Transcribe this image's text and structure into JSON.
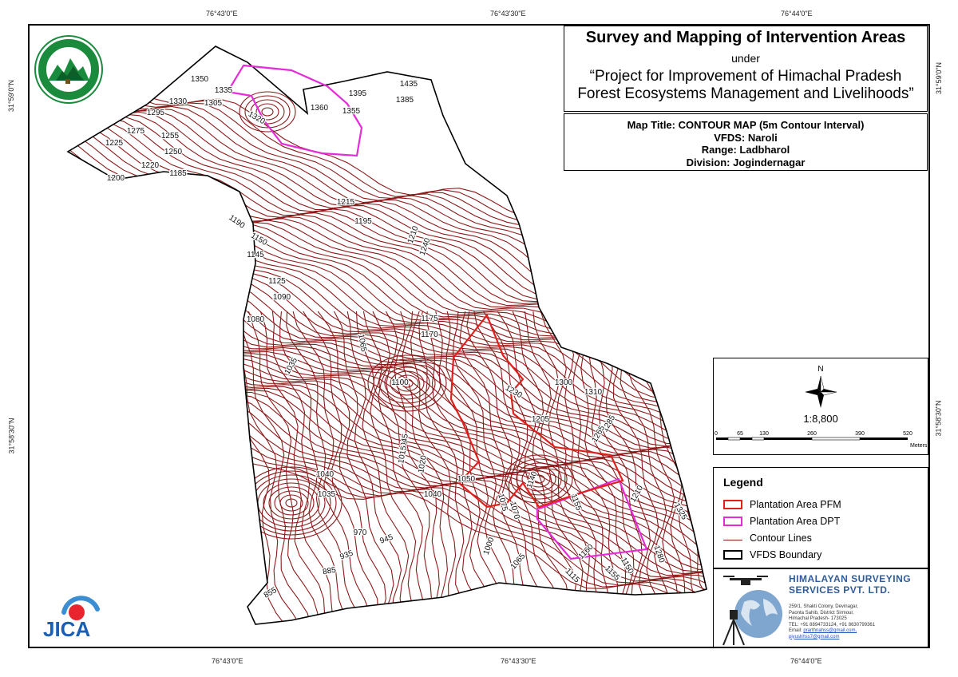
{
  "graticule": {
    "top_labels": [
      "76°43'0\"E",
      "76°43'30\"E",
      "76°44'0\"E"
    ],
    "bottom_labels": [
      "76°43'0\"E",
      "76°43'30\"E",
      "76°44'0\"E"
    ],
    "left_labels": [
      "31°59'0\"N",
      "31°58'30\"N"
    ],
    "right_labels": [
      "31°59'0\"N",
      "31°58'30\"N"
    ]
  },
  "title": {
    "main": "Survey and Mapping of Intervention Areas",
    "under": "under",
    "project_line1": "“Project for Improvement of Himachal Pradesh",
    "project_line2": "Forest Ecosystems Management and Livelihoods”"
  },
  "map_info": {
    "map_title": "Map Title: CONTOUR MAP (5m Contour Interval)",
    "vfds": "VFDS: Naroli",
    "range": "Range: Ladbharol",
    "division": "Division: Jogindernagar"
  },
  "scale": {
    "north": "N",
    "ratio": "1:8,800",
    "ticks": [
      "0",
      "65",
      "130",
      "260",
      "390",
      "520"
    ],
    "unit": "Meters"
  },
  "legend": {
    "title": "Legend",
    "items": [
      {
        "label": "Plantation Area PFM",
        "color": "#e0201c"
      },
      {
        "label": "Plantation Area DPT",
        "color": "#e52bd8"
      },
      {
        "label": "Contour Lines",
        "color": "#8b1a1a"
      },
      {
        "label": "VFDS Boundary",
        "color": "#000000"
      }
    ]
  },
  "company": {
    "name_line1": "HIMALAYAN SURVEYING",
    "name_line2": "SERVICES PVT. LTD.",
    "address": [
      "259/1, Shakti Colony, Devinagar,",
      "Paonta Sahib, District Sirmour,",
      "Himachal Pradesh- 173025"
    ],
    "phone": "TEL: +91 8894733124, +91 8630799361",
    "email_label": "Email:",
    "email1": "prarthnahss@gmail.com,",
    "email2": "piyushhss7@gmail.com"
  },
  "logos": {
    "hp_forest_top": "वन ही जल, विरजल बारा",
    "hp_forest_bottom": "वन विभाग हिमाचल प्रदेश",
    "jica": "JICA"
  },
  "contour_labels": [
    "1350",
    "1335",
    "1330",
    "1305",
    "1320",
    "1360",
    "1355",
    "1395",
    "1435",
    "1385",
    "1295",
    "1275",
    "1255",
    "1225",
    "1250",
    "1220",
    "1185",
    "1200",
    "1215",
    "1195",
    "1190",
    "1150",
    "1145",
    "1210",
    "1240",
    "1125",
    "1090",
    "1080",
    "1175",
    "1170",
    "1065",
    "1035",
    "1100",
    "1300",
    "1310",
    "1230",
    "1285",
    "1205",
    "1265",
    "1045",
    "1015",
    "1020",
    "1040",
    "1035",
    "1050",
    "1040",
    "1075",
    "1070",
    "1140",
    "1155",
    "1210",
    "1325",
    "970",
    "945",
    "935",
    "1000",
    "1065",
    "1160",
    "1155",
    "1115",
    "1150",
    "1280",
    "885",
    "855"
  ],
  "colors": {
    "contour": "#8b1a1a",
    "pfm": "#e0201c",
    "dpt": "#e52bd8",
    "company_blue": "#2f5d9a"
  }
}
